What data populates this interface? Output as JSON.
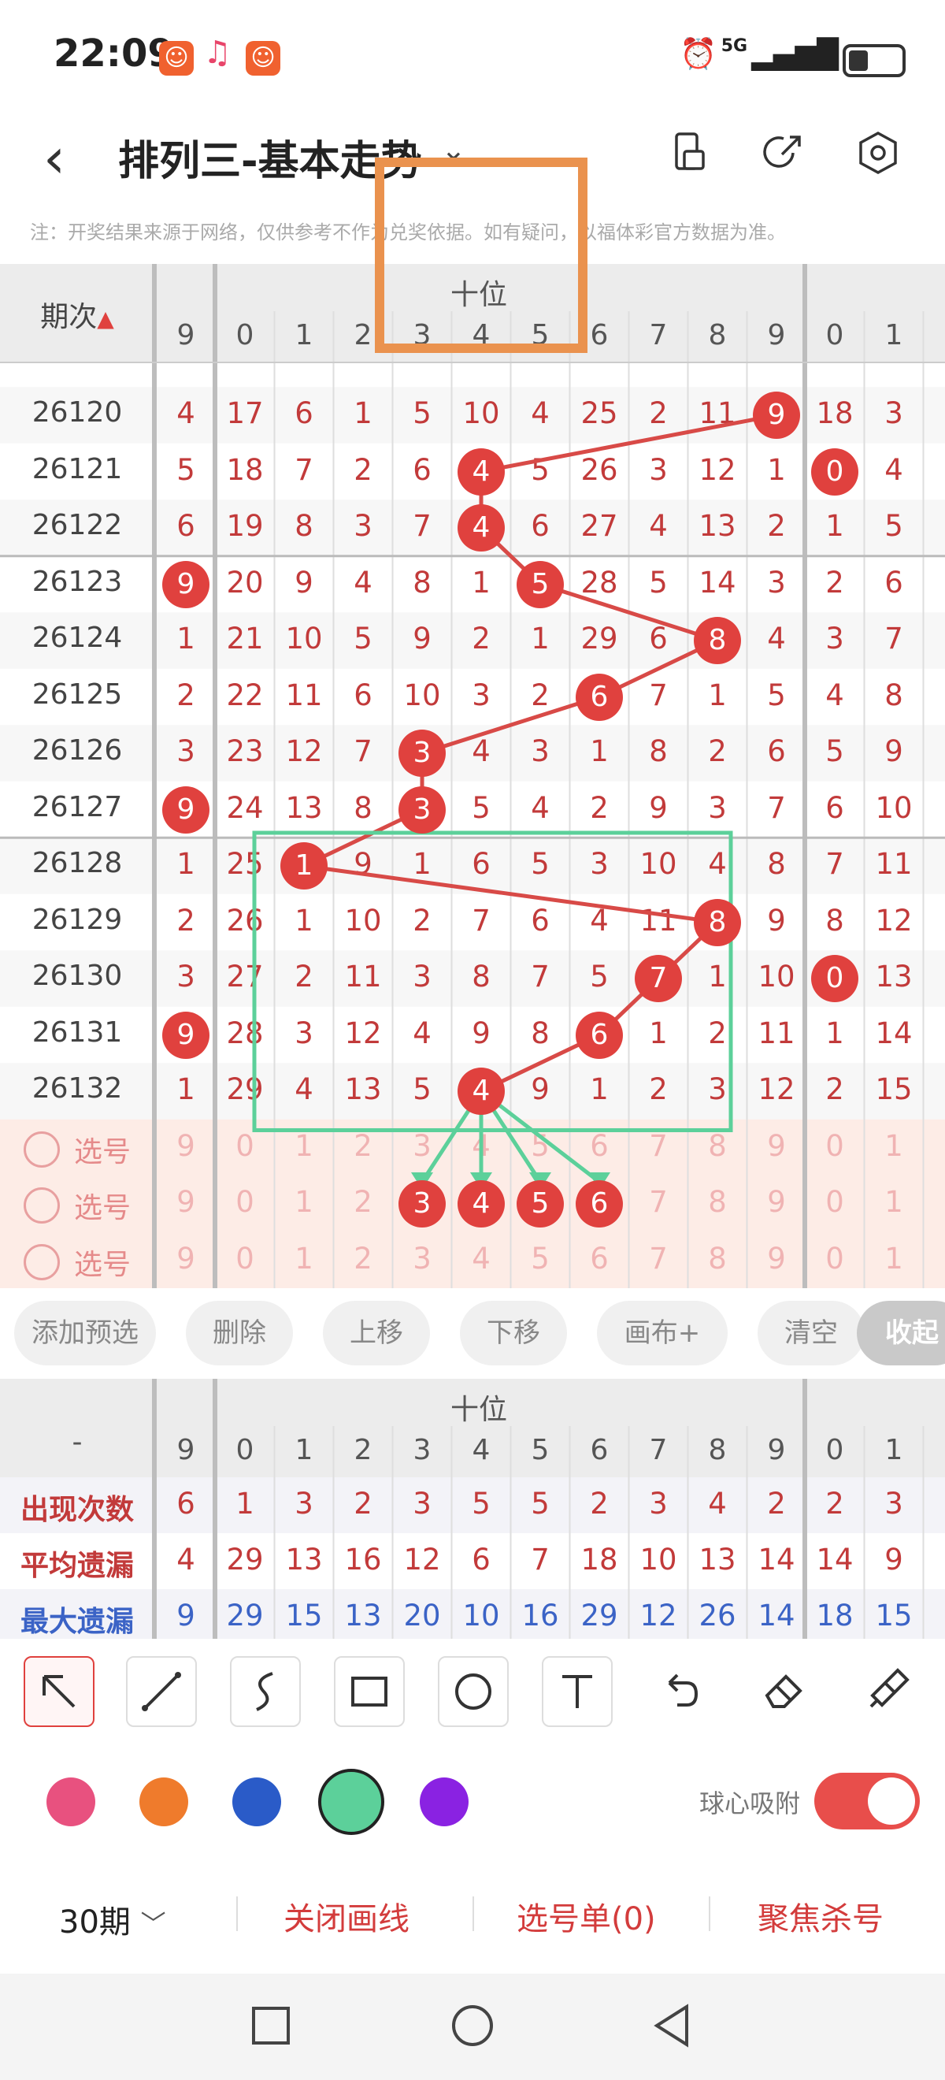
{
  "status_bar": {
    "time": "22:09",
    "network": "5G"
  },
  "header": {
    "title": "排列三-基本走势"
  },
  "notice": "注：开奖结果来源于网络，仅供参考不作为兑奖依据。如有疑问，以福体彩官方数据为准。",
  "grid": {
    "corner_label": "期次",
    "section_label": "十位",
    "columns": [
      "9",
      "0",
      "1",
      "2",
      "3",
      "4",
      "5",
      "6",
      "7",
      "8",
      "9",
      "0",
      "1"
    ],
    "rows": [
      {
        "period": "26120",
        "cells": [
          "4",
          "17",
          "6",
          "1",
          "5",
          "10",
          "4",
          "25",
          "2",
          "11",
          "9",
          "18",
          "3"
        ]
      },
      {
        "period": "26121",
        "cells": [
          "5",
          "18",
          "7",
          "2",
          "6",
          "4",
          "5",
          "26",
          "3",
          "12",
          "1",
          "0",
          "4"
        ]
      },
      {
        "period": "26122",
        "cells": [
          "6",
          "19",
          "8",
          "3",
          "7",
          "4",
          "6",
          "27",
          "4",
          "13",
          "2",
          "1",
          "5"
        ]
      },
      {
        "period": "26123",
        "cells": [
          "9",
          "20",
          "9",
          "4",
          "8",
          "1",
          "5",
          "28",
          "5",
          "14",
          "3",
          "2",
          "6"
        ]
      },
      {
        "period": "26124",
        "cells": [
          "1",
          "21",
          "10",
          "5",
          "9",
          "2",
          "1",
          "29",
          "6",
          "8",
          "4",
          "3",
          "7"
        ]
      },
      {
        "period": "26125",
        "cells": [
          "2",
          "22",
          "11",
          "6",
          "10",
          "3",
          "2",
          "6",
          "7",
          "1",
          "5",
          "4",
          "8"
        ]
      },
      {
        "period": "26126",
        "cells": [
          "3",
          "23",
          "12",
          "7",
          "3",
          "4",
          "3",
          "1",
          "8",
          "2",
          "6",
          "5",
          "9"
        ]
      },
      {
        "period": "26127",
        "cells": [
          "9",
          "24",
          "13",
          "8",
          "3",
          "5",
          "4",
          "2",
          "9",
          "3",
          "7",
          "6",
          "10"
        ]
      },
      {
        "period": "26128",
        "cells": [
          "1",
          "25",
          "1",
          "9",
          "1",
          "6",
          "5",
          "3",
          "10",
          "4",
          "8",
          "7",
          "11"
        ]
      },
      {
        "period": "26129",
        "cells": [
          "2",
          "26",
          "1",
          "10",
          "2",
          "7",
          "6",
          "4",
          "11",
          "8",
          "9",
          "8",
          "12"
        ]
      },
      {
        "period": "26130",
        "cells": [
          "3",
          "27",
          "2",
          "11",
          "3",
          "8",
          "7",
          "5",
          "7",
          "1",
          "10",
          "0",
          "13"
        ]
      },
      {
        "period": "26131",
        "cells": [
          "9",
          "28",
          "3",
          "12",
          "4",
          "9",
          "8",
          "6",
          "1",
          "2",
          "11",
          "1",
          "14"
        ]
      },
      {
        "period": "26132",
        "cells": [
          "1",
          "29",
          "4",
          "13",
          "5",
          "4",
          "9",
          "1",
          "2",
          "3",
          "12",
          "2",
          "15"
        ]
      }
    ],
    "select_label": "选号",
    "select_rows": [
      [
        "9",
        "0",
        "1",
        "2",
        "3",
        "4",
        "5",
        "6",
        "7",
        "8",
        "9",
        "0",
        "1"
      ],
      [
        "9",
        "0",
        "1",
        "2",
        "3",
        "4",
        "5",
        "6",
        "7",
        "8",
        "9",
        "0",
        "1"
      ],
      [
        "9",
        "0",
        "1",
        "2",
        "3",
        "4",
        "5",
        "6",
        "7",
        "8",
        "9",
        "0",
        "1"
      ]
    ]
  },
  "actions": {
    "add": "添加预选",
    "delete": "删除",
    "up": "上移",
    "down": "下移",
    "canvas": "画布+",
    "clear": "清空",
    "collapse": "收起"
  },
  "stats": {
    "corner": "-",
    "section_label": "十位",
    "columns": [
      "9",
      "0",
      "1",
      "2",
      "3",
      "4",
      "5",
      "6",
      "7",
      "8",
      "9",
      "0",
      "1"
    ],
    "rows": [
      {
        "label": "出现次数",
        "color": "#c23a3a",
        "values": [
          "6",
          "1",
          "3",
          "2",
          "3",
          "5",
          "5",
          "2",
          "3",
          "4",
          "2",
          "2",
          "3"
        ]
      },
      {
        "label": "平均遗漏",
        "color": "#c23a3a",
        "values": [
          "4",
          "29",
          "13",
          "16",
          "12",
          "6",
          "7",
          "18",
          "10",
          "13",
          "14",
          "14",
          "9"
        ]
      },
      {
        "label": "最大遗漏",
        "color": "#3b63c6",
        "values": [
          "9",
          "29",
          "15",
          "13",
          "20",
          "10",
          "16",
          "29",
          "12",
          "26",
          "14",
          "18",
          "15"
        ]
      }
    ]
  },
  "palette": {
    "colors": [
      "#e8517f",
      "#ef7b2c",
      "#2a5bc8",
      "#5cd09a",
      "#8a22e2"
    ],
    "selected": "#5cd09a"
  },
  "snap": {
    "label": "球心吸附",
    "on": true
  },
  "bottom": {
    "period": "30期",
    "close_lines": "关闭画线",
    "select_list": "选号单(0)",
    "focus": "聚焦杀号"
  }
}
